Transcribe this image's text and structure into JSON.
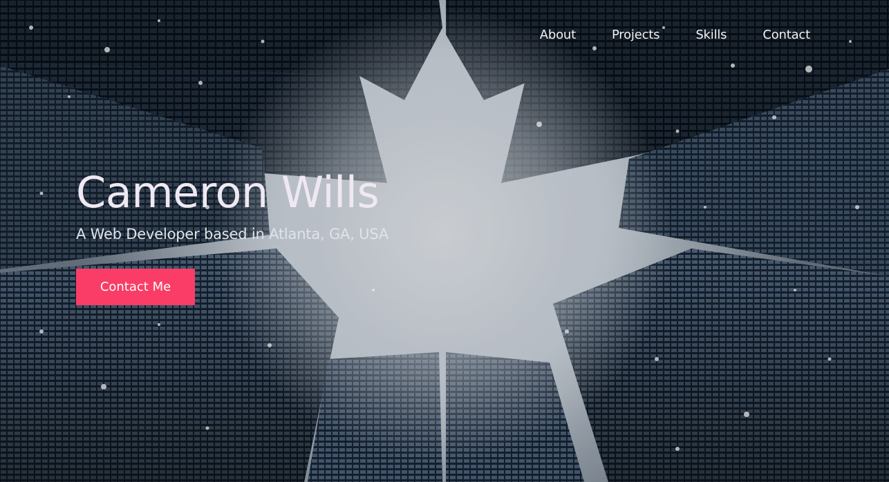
{
  "nav": {
    "items": [
      {
        "label": "About"
      },
      {
        "label": "Projects"
      },
      {
        "label": "Skills"
      },
      {
        "label": "Contact"
      }
    ]
  },
  "hero": {
    "name": "Cameron Wills",
    "tagline": "A Web Developer based in Atlanta, GA, USA",
    "cta_label": "Contact Me",
    "background_image": "skyscrapers-looking-up-in-snow",
    "colors": {
      "cta_background": "#f93d66",
      "text": "#efe8f2",
      "sky": "#cfd5dc"
    }
  }
}
